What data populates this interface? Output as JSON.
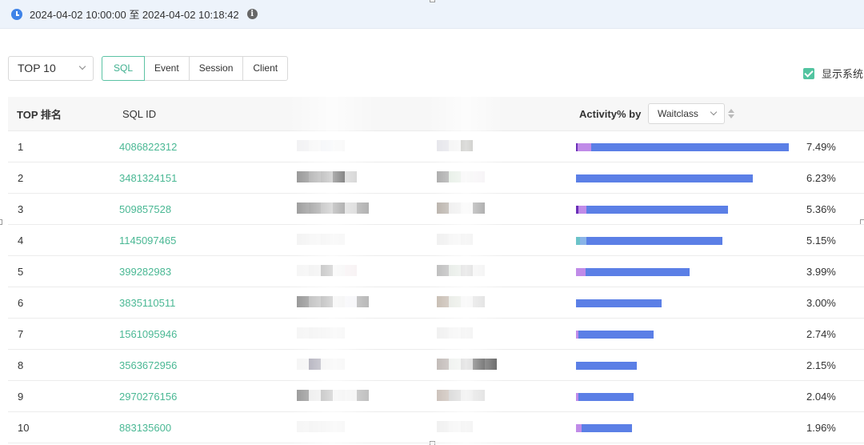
{
  "time_range": {
    "text": "2024-04-02 10:00:00 至 2024-04-02 10:18:42",
    "info_glyph": "i"
  },
  "toolbar": {
    "top_select": "TOP 10",
    "segments": [
      "SQL",
      "Event",
      "Session",
      "Client"
    ],
    "active_segment": "SQL",
    "show_system_label": "显示系统"
  },
  "table": {
    "headers": {
      "rank": "TOP 排名",
      "sql_id": "SQL ID",
      "activity": "Activity% by",
      "group_by": "Waitclass"
    },
    "rows": [
      {
        "rank": "1",
        "sql_id": "4086822312",
        "pct": "7.49%",
        "activity": 7.49
      },
      {
        "rank": "2",
        "sql_id": "3481324151",
        "pct": "6.23%",
        "activity": 6.23
      },
      {
        "rank": "3",
        "sql_id": "509857528",
        "pct": "5.36%",
        "activity": 5.36
      },
      {
        "rank": "4",
        "sql_id": "1145097465",
        "pct": "5.15%",
        "activity": 5.15
      },
      {
        "rank": "5",
        "sql_id": "399282983",
        "pct": "3.99%",
        "activity": 3.99
      },
      {
        "rank": "6",
        "sql_id": "3835110511",
        "pct": "3.00%",
        "activity": 3.0
      },
      {
        "rank": "7",
        "sql_id": "1561095946",
        "pct": "2.74%",
        "activity": 2.74
      },
      {
        "rank": "8",
        "sql_id": "3563672956",
        "pct": "2.15%",
        "activity": 2.15
      },
      {
        "rank": "9",
        "sql_id": "2970276156",
        "pct": "2.04%",
        "activity": 2.04
      },
      {
        "rank": "10",
        "sql_id": "883135600",
        "pct": "1.96%",
        "activity": 1.96
      }
    ]
  },
  "colors": {
    "accent": "#4ab894",
    "bar_main": "#5b7fe6",
    "bar_purple": "#c08be8",
    "bar_dark": "#6a2fb8",
    "bar_teal": "#6cc3c9"
  }
}
